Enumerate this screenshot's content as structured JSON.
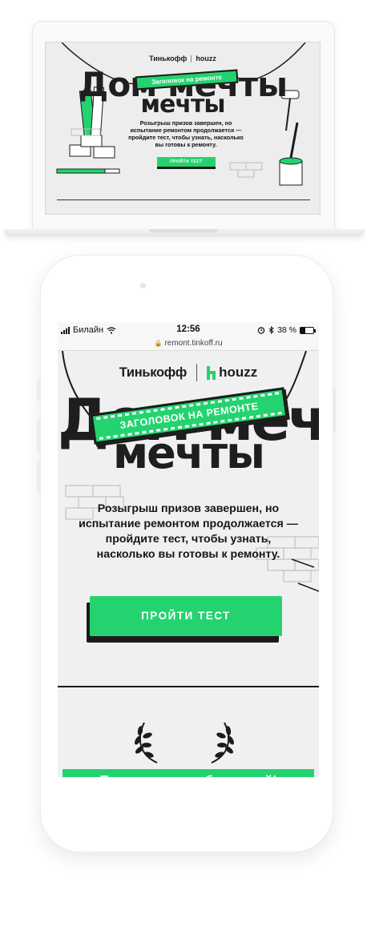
{
  "laptop": {
    "brand_tinkoff": "Тинькофф",
    "brand_houzz": "houzz",
    "headline_line1": "Дом мечты",
    "headline_line2": "мечты",
    "banner_text": "Заголовок на ремонте",
    "description": "Розыгрыш призов завершен, но испытание ремонтом продолжается — пройдите тест, чтобы узнать, насколько вы готовы к ремонту.",
    "cta_label": "ПРОЙТИ ТЕСТ"
  },
  "phone": {
    "status": {
      "carrier": "Билайн",
      "time": "12:56",
      "battery_text": "38 %",
      "battery_level": 0.38
    },
    "url": "remont.tinkoff.ru",
    "brand_tinkoff": "Тинькофф",
    "brand_houzz": "houzz",
    "headline_line1": "Дом мечты",
    "headline_line2": "мечты",
    "banner_text": "ЗАГОЛОВОК НА РЕМОНТЕ",
    "description": "Розыгрыш призов завершен, но испытание ремонтом продолжается — пройдите тест, чтобы узнать, насколько вы готовы к ремонту.",
    "cta_label": "ПРОЙТИ ТЕСТ",
    "winners_label": "Поздравляем победителей!"
  },
  "colors": {
    "accent": "#24d36f",
    "dark": "#1b1b1b",
    "page_bg": "#f0f0f0"
  }
}
